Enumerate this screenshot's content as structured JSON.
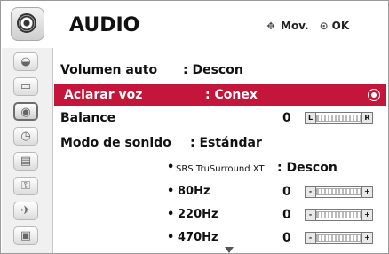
{
  "header": {
    "title": "AUDIO",
    "move_hint": "Mov.",
    "ok_hint": "OK"
  },
  "sidebar": {
    "items": [
      {
        "icon": "picture-icon"
      },
      {
        "icon": "screen-icon"
      },
      {
        "icon": "audio-icon",
        "active": true
      },
      {
        "icon": "time-icon"
      },
      {
        "icon": "options-icon"
      },
      {
        "icon": "lock-icon"
      },
      {
        "icon": "input-icon"
      },
      {
        "icon": "media-icon"
      }
    ]
  },
  "menu": {
    "volumen_auto": {
      "label": "Volumen auto",
      "value": ": Descon"
    },
    "aclarar_voz": {
      "label": "Aclarar voz",
      "value": ": Conex"
    },
    "balance": {
      "label": "Balance",
      "value": "0",
      "left_cap": "L",
      "right_cap": "R"
    },
    "modo_sonido": {
      "label": "Modo de sonido",
      "value": ": Estándar"
    },
    "srs": {
      "bullet": "•",
      "label": "SRS TruSurround XT",
      "value": ": Descon"
    },
    "eq": [
      {
        "bullet": "•",
        "label": "80Hz",
        "value": "0",
        "left_cap": "-",
        "right_cap": "+"
      },
      {
        "bullet": "•",
        "label": "220Hz",
        "value": "0",
        "left_cap": "-",
        "right_cap": "+"
      },
      {
        "bullet": "•",
        "label": "470Hz",
        "value": "0",
        "left_cap": "-",
        "right_cap": "+"
      }
    ]
  },
  "colors": {
    "selected_bg": "#c3163a",
    "sidebar_bg": "#f0f0f0"
  }
}
